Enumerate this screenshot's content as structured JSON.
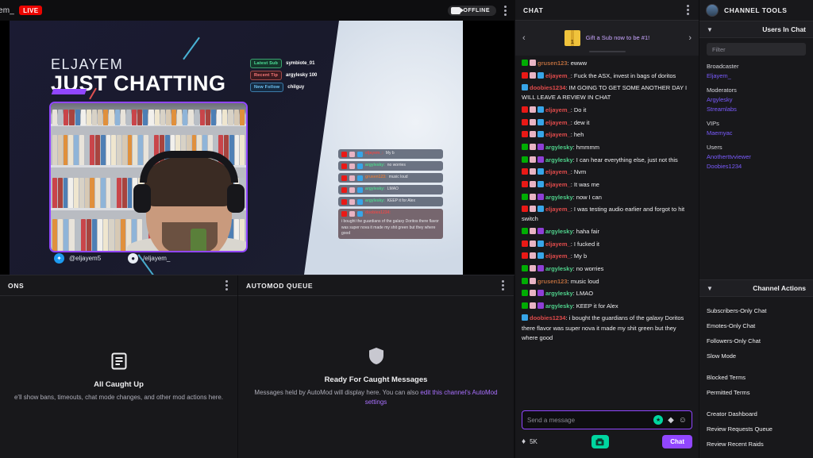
{
  "topbar": {
    "channel": "em_",
    "live_label": "LIVE",
    "stream_status": "OFFLINE",
    "menu_icon": "kebab-menu-icon",
    "camera_icon": "camera-icon"
  },
  "stream": {
    "title_small": "ELJAYEM",
    "title_big": "JUST CHATTING",
    "alerts": [
      {
        "tag": "Latest Sub",
        "value": "symbiote_01",
        "style": "sub"
      },
      {
        "tag": "Recent Tip",
        "value": "argylesky 100",
        "style": "tip"
      },
      {
        "tag": "New Follow",
        "value": "chilguy",
        "style": "follow"
      }
    ],
    "overlay_chat": [
      {
        "user": "eljayem_",
        "color": "#e04b4b",
        "text": "My b",
        "alt": false
      },
      {
        "user": "argylesky",
        "color": "#4fd18b",
        "text": "no worries",
        "alt": false
      },
      {
        "user": "grusen123",
        "color": "#d97b3f",
        "text": "music loud",
        "alt": false
      },
      {
        "user": "argylesky",
        "color": "#4fd18b",
        "text": "LMAO",
        "alt": false
      },
      {
        "user": "argylesky",
        "color": "#4fd18b",
        "text": "KEEP it for Alex",
        "alt": false
      },
      {
        "user": "doobies1234",
        "color": "#e04b4b",
        "text": "i bought the guardians of the galaxy Doritos there flavor was super nova it made my shit green but they where good",
        "alt": true
      }
    ],
    "socials": [
      {
        "icon": "twitter-icon",
        "handle": "@eljayem5"
      },
      {
        "icon": "social-icon",
        "handle": "/eljayem_"
      }
    ]
  },
  "mod_actions_panel": {
    "title": "ONS",
    "empty_title": "All Caught Up",
    "empty_sub": "e'll show bans, timeouts, chat mode changes, and other mod actions here.",
    "icon": "document-icon",
    "menu_icon": "kebab-menu-icon"
  },
  "automod_panel": {
    "title": "AUTOMOD QUEUE",
    "empty_title": "Ready For Caught Messages",
    "empty_sub": "Messages held by AutoMod will display here. You can also ",
    "empty_link": "edit this channel's AutoMod settings",
    "icon": "shield-icon",
    "menu_icon": "kebab-menu-icon"
  },
  "chat": {
    "title": "CHAT",
    "menu_icon": "kebab-menu-icon",
    "banner": {
      "text": "Gift a Sub now to be #1!",
      "icon": "gift-box-icon",
      "prev_icon": "chevron-left-icon",
      "next_icon": "chevron-right-icon"
    },
    "messages": [
      {
        "user": "grusen123",
        "color": "#b56a3c",
        "text": "ewww",
        "badges": [
          "mod",
          "sub"
        ]
      },
      {
        "user": "eljayem_",
        "color": "#e04b4b",
        "text": "Fuck the ASX, invest in bags of doritos",
        "badges": [
          "broadcaster",
          "sub",
          "prime"
        ]
      },
      {
        "user": "doobies1234",
        "color": "#e04b4b",
        "text": "IM GOING TO GET SOME ANOTHER DAY I WILL LEAVE A REVIEW IN CHAT",
        "badges": [
          "prime"
        ]
      },
      {
        "user": "eljayem_",
        "color": "#e04b4b",
        "text": "Do it",
        "badges": [
          "broadcaster",
          "sub",
          "prime"
        ]
      },
      {
        "user": "eljayem_",
        "color": "#e04b4b",
        "text": "dew it",
        "badges": [
          "broadcaster",
          "sub",
          "prime"
        ]
      },
      {
        "user": "eljayem_",
        "color": "#e04b4b",
        "text": "heh",
        "badges": [
          "broadcaster",
          "sub",
          "prime"
        ]
      },
      {
        "user": "argylesky",
        "color": "#4fd18b",
        "text": "hmmmm",
        "badges": [
          "mod",
          "sub",
          "vip"
        ]
      },
      {
        "user": "argylesky",
        "color": "#4fd18b",
        "text": "I can hear everything else, just not this",
        "badges": [
          "mod",
          "sub",
          "vip"
        ]
      },
      {
        "user": "eljayem_",
        "color": "#e04b4b",
        "text": "Nvm",
        "badges": [
          "broadcaster",
          "sub",
          "prime"
        ]
      },
      {
        "user": "eljayem_",
        "color": "#e04b4b",
        "text": "It was me",
        "badges": [
          "broadcaster",
          "sub",
          "prime"
        ]
      },
      {
        "user": "argylesky",
        "color": "#4fd18b",
        "text": "now I can",
        "badges": [
          "mod",
          "sub",
          "vip"
        ]
      },
      {
        "user": "eljayem_",
        "color": "#e04b4b",
        "text": "I was testing audio earlier and forgot to hit switch",
        "badges": [
          "broadcaster",
          "sub",
          "prime"
        ]
      },
      {
        "user": "argylesky",
        "color": "#4fd18b",
        "text": "haha fair",
        "badges": [
          "mod",
          "sub",
          "vip"
        ]
      },
      {
        "user": "eljayem_",
        "color": "#e04b4b",
        "text": "I fucked it",
        "badges": [
          "broadcaster",
          "sub",
          "prime"
        ]
      },
      {
        "user": "eljayem_",
        "color": "#e04b4b",
        "text": "My b",
        "badges": [
          "broadcaster",
          "sub",
          "prime"
        ]
      },
      {
        "user": "argylesky",
        "color": "#4fd18b",
        "text": "no worries",
        "badges": [
          "mod",
          "sub",
          "vip"
        ]
      },
      {
        "user": "grusen123",
        "color": "#b56a3c",
        "text": "music loud",
        "badges": [
          "mod",
          "sub"
        ]
      },
      {
        "user": "argylesky",
        "color": "#4fd18b",
        "text": "LMAO",
        "badges": [
          "mod",
          "sub",
          "vip"
        ]
      },
      {
        "user": "argylesky",
        "color": "#4fd18b",
        "text": "KEEP it for Alex",
        "badges": [
          "mod",
          "sub",
          "vip"
        ]
      },
      {
        "user": "doobies1234",
        "color": "#e04b4b",
        "text": "i bought the guardians of the galaxy Doritos there flavor was super nova it made my shit green but they where good",
        "badges": [
          "prime"
        ]
      }
    ],
    "input_placeholder": "Send a message",
    "input_value": "",
    "bits_count": "5K",
    "send_label": "Chat",
    "emote_icon": "emote-icon",
    "bits_icon": "bits-icon",
    "mod_icon": "mod-tools-icon",
    "highlight_icon": "highlight-icon"
  },
  "sidebar": {
    "title": "CHANNEL TOOLS",
    "avatar_icon": "avatar",
    "users_section": {
      "title": "Users In Chat",
      "chevron": "chevron-down-icon",
      "filter_placeholder": "Filter",
      "filter_value": "",
      "groups": [
        {
          "label": "Broadcaster",
          "users": [
            "Eljayem_"
          ]
        },
        {
          "label": "Moderators",
          "users": [
            "Argylesky",
            "Streamlabs"
          ]
        },
        {
          "label": "VIPs",
          "users": [
            "Maemyac"
          ]
        },
        {
          "label": "Users",
          "users": [
            "Anotherttvviewer",
            "Doobies1234"
          ]
        }
      ]
    },
    "actions_section": {
      "title": "Channel Actions",
      "chevron": "chevron-down-icon",
      "groups": [
        [
          "Subscribers-Only Chat",
          "Emotes-Only Chat",
          "Followers-Only Chat",
          "Slow Mode"
        ],
        [
          "Blocked Terms",
          "Permitted Terms"
        ],
        [
          "Creator Dashboard",
          "Review Requests Queue",
          "Review Recent Raids"
        ]
      ]
    }
  },
  "colors": {
    "brand_purple": "#9146ff",
    "live_red": "#eb0400",
    "link_purple": "#a970ff",
    "accent_teal": "#00d6a0"
  }
}
